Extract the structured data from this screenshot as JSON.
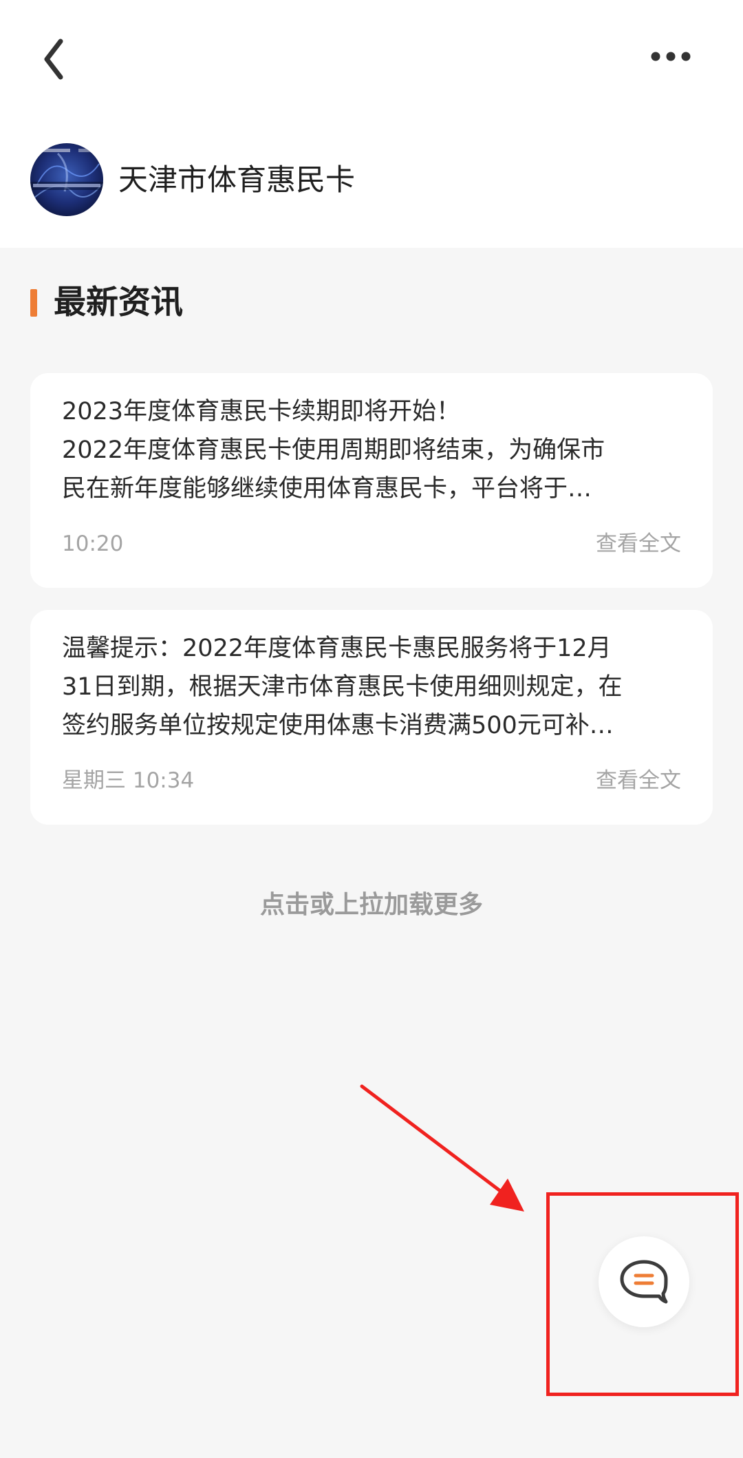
{
  "header": {
    "back_icon": "chevron-left-icon",
    "more_icon": "more-horizontal-icon",
    "account_name": "天津市体育惠民卡"
  },
  "section": {
    "title": "最新资讯",
    "accent_color": "#ee7d35"
  },
  "news": [
    {
      "lines": [
        "2023年度体育惠民卡续期即将开始！",
        "2022年度体育惠民卡使用周期即将结束，为确保市",
        "民在新年度能够继续使用体育惠民卡，平台将于…"
      ],
      "time": "10:20",
      "link": "查看全文"
    },
    {
      "lines": [
        "温馨提示：2022年度体育惠民卡惠民服务将于12月",
        "31日到期，根据天津市体育惠民卡使用细则规定，在",
        "签约服务单位按规定使用体惠卡消费满500元可补…"
      ],
      "time": "星期三 10:34",
      "link": "查看全文"
    }
  ],
  "load_more": "点击或上拉加载更多",
  "chat_button": {
    "icon": "chat-bubble-icon",
    "accent_color": "#ee7d35"
  },
  "annotation": {
    "color": "#f0221f"
  }
}
